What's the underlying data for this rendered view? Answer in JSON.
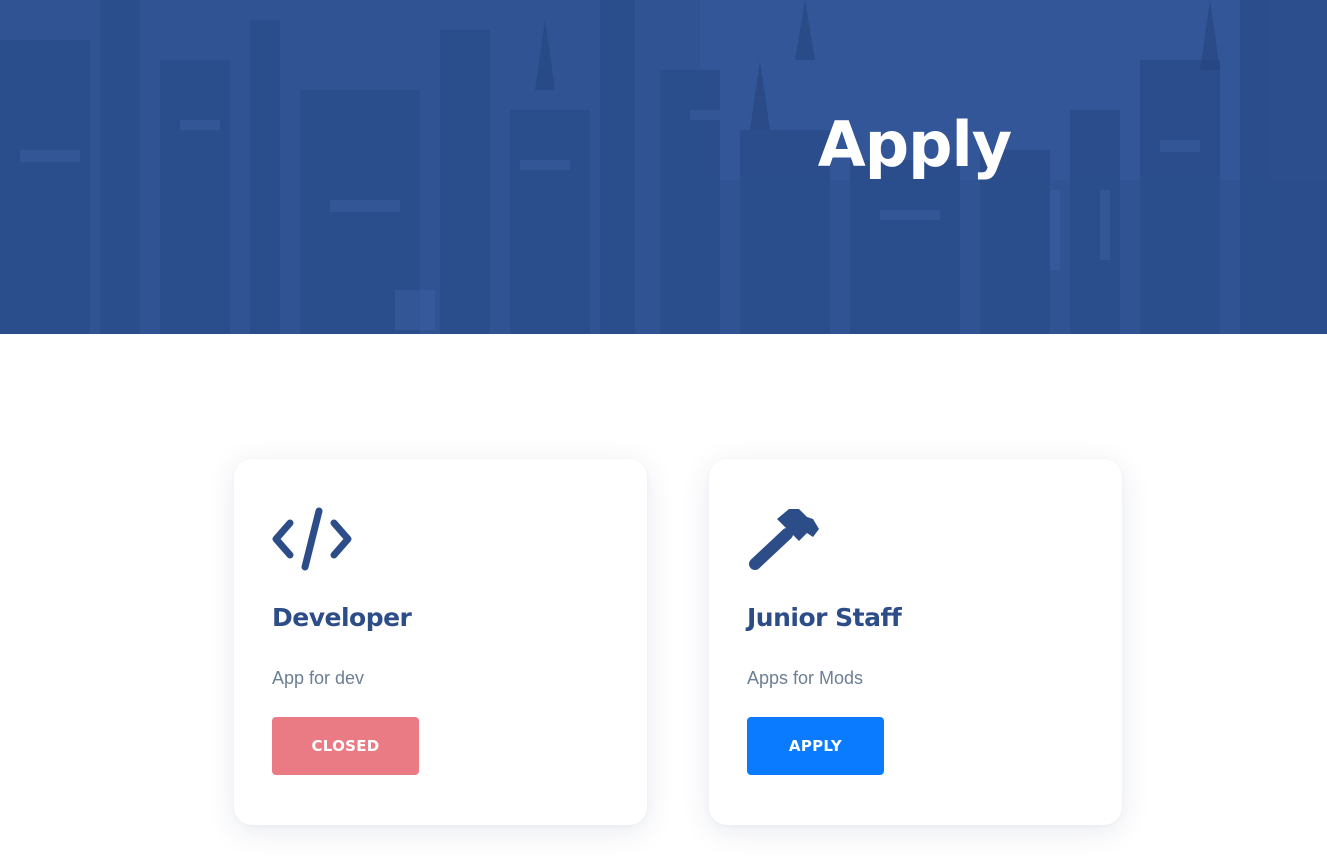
{
  "hero": {
    "title": "Apply",
    "overlay_color": "#2f5393"
  },
  "cards": [
    {
      "icon": "code-icon",
      "title": "Developer",
      "description": "App for dev",
      "button_label": "CLOSED",
      "button_color": "#ea7b85",
      "status": "closed"
    },
    {
      "icon": "hammer-icon",
      "title": "Junior Staff",
      "description": "Apps for Mods",
      "button_label": "APPLY",
      "button_color": "#0a7bff",
      "status": "open"
    }
  ],
  "colors": {
    "heading": "#2d4d88",
    "text_muted": "#6c7f95",
    "icon": "#2d4d88"
  }
}
